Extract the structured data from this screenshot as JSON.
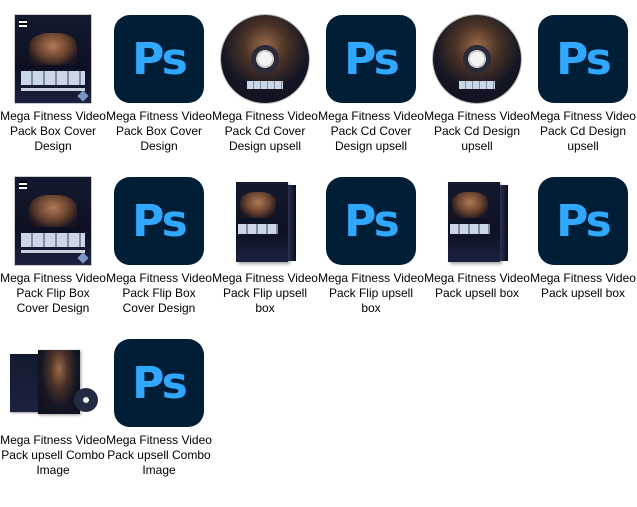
{
  "files": [
    {
      "label": "Mega Fitness Video Pack Box Cover Design",
      "thumb": "cover"
    },
    {
      "label": "Mega Fitness Video Pack Box Cover Design",
      "thumb": "ps"
    },
    {
      "label": "Mega Fitness Video Pack Cd Cover Design upsell",
      "thumb": "cd"
    },
    {
      "label": "Mega Fitness Video Pack Cd Cover Design upsell",
      "thumb": "ps"
    },
    {
      "label": "Mega Fitness Video Pack Cd Design upsell",
      "thumb": "cd"
    },
    {
      "label": "Mega Fitness Video Pack Cd Design upsell",
      "thumb": "ps"
    },
    {
      "label": "Mega Fitness Video Pack Flip Box Cover Design",
      "thumb": "cover"
    },
    {
      "label": "Mega Fitness Video Pack Flip Box Cover Design",
      "thumb": "ps"
    },
    {
      "label": "Mega Fitness Video Pack Flip upsell box",
      "thumb": "box3d"
    },
    {
      "label": "Mega Fitness Video Pack Flip upsell box",
      "thumb": "ps"
    },
    {
      "label": "Mega Fitness Video Pack upsell box",
      "thumb": "box3d"
    },
    {
      "label": "Mega Fitness Video Pack upsell box",
      "thumb": "ps"
    },
    {
      "label": "Mega Fitness Video Pack upsell Combo Image",
      "thumb": "combo"
    },
    {
      "label": "Mega Fitness Video Pack upsell Combo Image",
      "thumb": "ps"
    }
  ],
  "icons": {
    "ps_text": "Ps",
    "brand_text": "Mega Fitness",
    "ps_bg": "#001e36",
    "ps_fg": "#31a8ff"
  }
}
